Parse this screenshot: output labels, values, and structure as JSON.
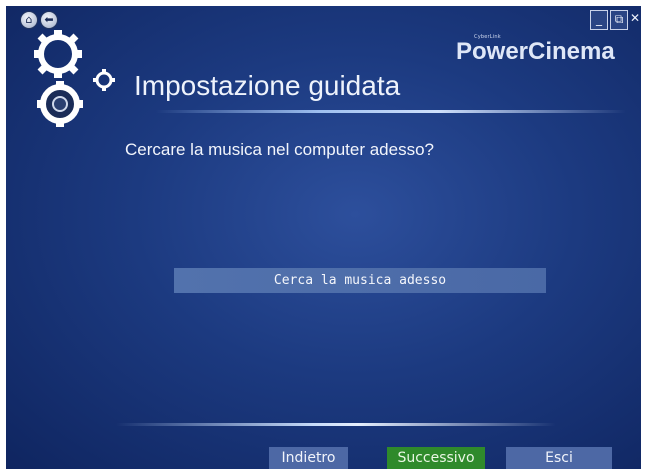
{
  "app": {
    "brand_small": "CyberLink",
    "brand": "PowerCinema"
  },
  "top_controls": {
    "home_icon": "home-icon",
    "back_icon": "back-arrow-icon",
    "minimize_icon": "minimize-icon",
    "restore_icon": "restore-icon",
    "close_icon": "close-icon"
  },
  "page": {
    "title": "Impostazione guidata",
    "question": "Cercare la musica nel computer adesso?",
    "action_label": "Cerca la musica adesso"
  },
  "footer": {
    "back_label": "Indietro",
    "next_label": "Successivo",
    "exit_label": "Esci"
  },
  "colors": {
    "background": "#1c3a80",
    "button": "#4d68a5",
    "next_button": "#2f8a2b"
  }
}
